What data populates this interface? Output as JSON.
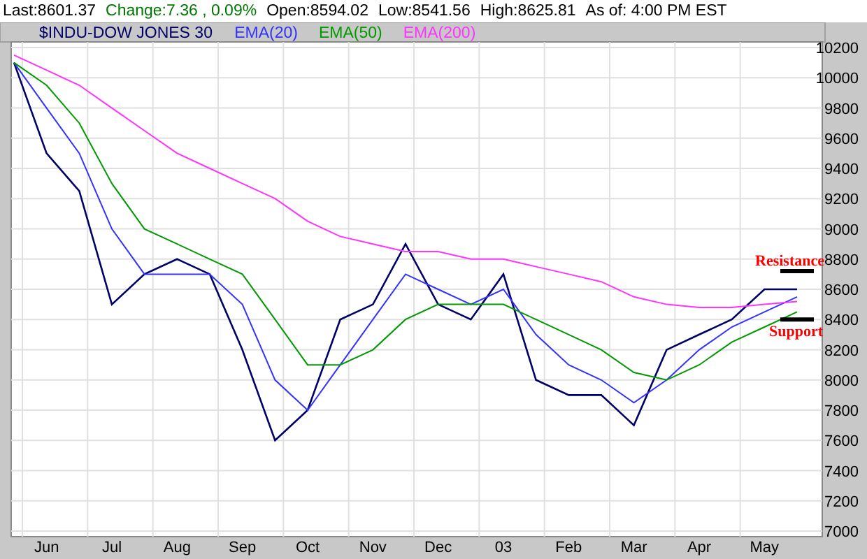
{
  "quote": {
    "items": [
      {
        "text": "Last:8601.37",
        "color": "#000000"
      },
      {
        "text": "Change:7.36 , 0.09%",
        "color": "#007700"
      },
      {
        "text": "Open:8594.02",
        "color": "#000000"
      },
      {
        "text": "Low:8541.56",
        "color": "#000000"
      },
      {
        "text": "High:8625.81",
        "color": "#000000"
      },
      {
        "text": "As of: 4:00 PM EST",
        "color": "#000000"
      }
    ]
  },
  "chart": {
    "chart_data": {
      "type": "line",
      "categories": [
        null,
        "Jun",
        null,
        "Jul",
        null,
        "Aug",
        null,
        "Sep",
        null,
        "Oct",
        null,
        "Nov",
        null,
        "Dec",
        null,
        "03",
        null,
        "Feb",
        null,
        "Mar",
        null,
        "Apr",
        null,
        "May",
        null
      ],
      "series": [
        {
          "name": "$INDU-DOW JONES 30",
          "color": "#000066",
          "values": [
            10100,
            9500,
            9250,
            8500,
            8700,
            8800,
            8700,
            8200,
            7600,
            7800,
            8400,
            8500,
            8900,
            8500,
            8400,
            8700,
            8000,
            7900,
            7900,
            7700,
            8200,
            8300,
            8400,
            8600,
            8600
          ]
        },
        {
          "name": "EMA(20)",
          "color": "#3333ff",
          "values": [
            10100,
            9800,
            9500,
            9000,
            8700,
            8700,
            8700,
            8500,
            8000,
            7800,
            8100,
            8400,
            8700,
            8600,
            8500,
            8600,
            8300,
            8100,
            8000,
            7850,
            8000,
            8200,
            8350,
            8450,
            8550
          ]
        },
        {
          "name": "EMA(50)",
          "color": "#009900",
          "values": [
            10100,
            9950,
            9700,
            9300,
            9000,
            8900,
            8800,
            8700,
            8400,
            8100,
            8100,
            8200,
            8400,
            8500,
            8500,
            8500,
            8400,
            8300,
            8200,
            8050,
            8000,
            8100,
            8250,
            8350,
            8450
          ]
        },
        {
          "name": "EMA(200)",
          "color": "#ff33ff",
          "values": [
            10150,
            10050,
            9950,
            9800,
            9650,
            9500,
            9400,
            9300,
            9200,
            9050,
            8950,
            8900,
            8850,
            8850,
            8800,
            8800,
            8750,
            8700,
            8650,
            8550,
            8500,
            8480,
            8480,
            8500,
            8520
          ]
        }
      ],
      "ylim": [
        7000,
        10200
      ],
      "grid": true,
      "yticks": [
        7000,
        7200,
        7400,
        7600,
        7800,
        8000,
        8200,
        8400,
        8600,
        8800,
        9000,
        9200,
        9400,
        9600,
        9800,
        10000,
        10200
      ],
      "annotations": [
        "Resistance",
        "Support"
      ]
    }
  }
}
